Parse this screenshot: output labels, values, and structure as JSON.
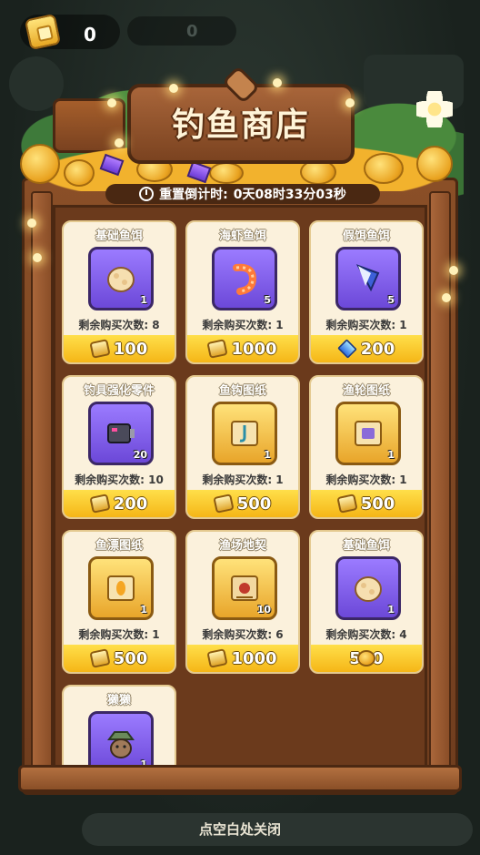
{
  "hud": {
    "tickets": "0",
    "coins": "0"
  },
  "shop": {
    "title": "钓鱼商店",
    "timer_label": "重置倒计时:",
    "timer_value": "0天08时33分03秒",
    "items": [
      {
        "name": "基础鱼饵",
        "qty": "1",
        "remaining": "剩余购买次数: 8",
        "price": "100",
        "currency": "ticket",
        "art": "bait-icon",
        "box": "purple"
      },
      {
        "name": "海虾鱼饵",
        "qty": "5",
        "remaining": "剩余购买次数: 1",
        "price": "1000",
        "currency": "ticket",
        "art": "shrimp-icon",
        "box": "purple"
      },
      {
        "name": "假饵鱼饵",
        "qty": "5",
        "remaining": "剩余购买次数: 1",
        "price": "200",
        "currency": "diamond",
        "art": "lure-icon",
        "box": "purple"
      },
      {
        "name": "钓具强化零件",
        "qty": "20",
        "remaining": "剩余购买次数: 10",
        "price": "200",
        "currency": "ticket",
        "art": "part-icon",
        "box": "purple"
      },
      {
        "name": "鱼钩图纸",
        "qty": "1",
        "remaining": "剩余购买次数: 1",
        "price": "500",
        "currency": "ticket",
        "art": "scroll-icon",
        "box": "gold"
      },
      {
        "name": "渔轮图纸",
        "qty": "1",
        "remaining": "剩余购买次数: 1",
        "price": "500",
        "currency": "ticket",
        "art": "scroll-icon",
        "box": "gold"
      },
      {
        "name": "鱼漂图纸",
        "qty": "1",
        "remaining": "剩余购买次数: 1",
        "price": "500",
        "currency": "ticket",
        "art": "scroll-icon",
        "box": "gold"
      },
      {
        "name": "渔场地契",
        "qty": "10",
        "remaining": "剩余购买次数: 6",
        "price": "1000",
        "currency": "ticket",
        "art": "deed-icon",
        "box": "gold"
      },
      {
        "name": "基础鱼饵",
        "qty": "1",
        "remaining": "剩余购买次数: 4",
        "price": "500",
        "currency": "coin",
        "art": "bait-icon",
        "box": "purple"
      },
      {
        "name": "獭獭",
        "qty": "1",
        "remaining": "",
        "price": "",
        "currency": "",
        "art": "otter-icon",
        "box": "purple"
      }
    ]
  },
  "close_hint": "点空白处关闭",
  "colors": {
    "wood": "#8a4f27",
    "card_bg": "#fbf1dc",
    "price_bar": "#f5b617",
    "purple_box": "#7b5ae8"
  }
}
